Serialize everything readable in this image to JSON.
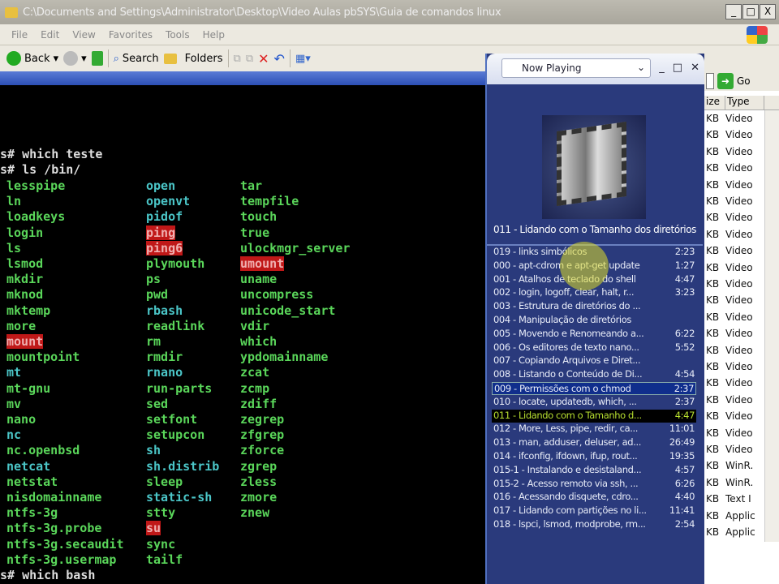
{
  "window": {
    "title": "C:\\Documents and Settings\\Administrator\\Desktop\\Video Aulas pbSYS\\Guia de comandos linux",
    "controls": [
      "_",
      "□",
      "X"
    ]
  },
  "menu": [
    "File",
    "Edit",
    "View",
    "Favorites",
    "Tools",
    "Help"
  ],
  "toolbar": {
    "back": "Back",
    "search": "Search",
    "folders": "Folders",
    "go": "Go"
  },
  "terminal": {
    "lines_top": [
      "s# which teste",
      "s# ls /bin/"
    ],
    "line_bottom": "s# which bash",
    "columns": [
      [
        [
          "lesspipe",
          "g"
        ],
        [
          "ln",
          "g"
        ],
        [
          "loadkeys",
          "g"
        ],
        [
          "login",
          "g"
        ],
        [
          "ls",
          "g"
        ],
        [
          "lsmod",
          "g"
        ],
        [
          "mkdir",
          "g"
        ],
        [
          "mknod",
          "g"
        ],
        [
          "mktemp",
          "g"
        ],
        [
          "more",
          "g"
        ],
        [
          "mount",
          "r"
        ],
        [
          "mountpoint",
          "g"
        ],
        [
          "mt",
          "c"
        ],
        [
          "mt-gnu",
          "g"
        ],
        [
          "mv",
          "g"
        ],
        [
          "nano",
          "g"
        ],
        [
          "nc",
          "c"
        ],
        [
          "nc.openbsd",
          "g"
        ],
        [
          "netcat",
          "c"
        ],
        [
          "netstat",
          "g"
        ],
        [
          "nisdomainname",
          "g"
        ],
        [
          "ntfs-3g",
          "g"
        ],
        [
          "ntfs-3g.probe",
          "g"
        ],
        [
          "ntfs-3g.secaudit",
          "g"
        ],
        [
          "ntfs-3g.usermap",
          "g"
        ]
      ],
      [
        [
          "open",
          "c"
        ],
        [
          "openvt",
          "c"
        ],
        [
          "pidof",
          "c"
        ],
        [
          "ping",
          "r"
        ],
        [
          "ping6",
          "r"
        ],
        [
          "plymouth",
          "g"
        ],
        [
          "ps",
          "g"
        ],
        [
          "pwd",
          "g"
        ],
        [
          "rbash",
          "c"
        ],
        [
          "readlink",
          "g"
        ],
        [
          "rm",
          "g"
        ],
        [
          "rmdir",
          "g"
        ],
        [
          "rnano",
          "c"
        ],
        [
          "run-parts",
          "g"
        ],
        [
          "sed",
          "g"
        ],
        [
          "setfont",
          "g"
        ],
        [
          "setupcon",
          "g"
        ],
        [
          "sh",
          "c"
        ],
        [
          "sh.distrib",
          "c"
        ],
        [
          "sleep",
          "g"
        ],
        [
          "static-sh",
          "c"
        ],
        [
          "stty",
          "g"
        ],
        [
          "su",
          "r"
        ],
        [
          "sync",
          "g"
        ],
        [
          "tailf",
          "g"
        ]
      ],
      [
        [
          "tar",
          "g"
        ],
        [
          "tempfile",
          "g"
        ],
        [
          "touch",
          "g"
        ],
        [
          "true",
          "g"
        ],
        [
          "ulockmgr_server",
          "g"
        ],
        [
          "umount",
          "r"
        ],
        [
          "uname",
          "g"
        ],
        [
          "uncompress",
          "g"
        ],
        [
          "unicode_start",
          "g"
        ],
        [
          "vdir",
          "g"
        ],
        [
          "which",
          "g"
        ],
        [
          "ypdomainname",
          "g"
        ],
        [
          "zcat",
          "g"
        ],
        [
          "zcmp",
          "g"
        ],
        [
          "zdiff",
          "g"
        ],
        [
          "zegrep",
          "g"
        ],
        [
          "zfgrep",
          "g"
        ],
        [
          "zforce",
          "g"
        ],
        [
          "zgrep",
          "g"
        ],
        [
          "zless",
          "g"
        ],
        [
          "zmore",
          "g"
        ],
        [
          "znew",
          "g"
        ]
      ]
    ]
  },
  "player": {
    "view": "Now Playing",
    "now_playing": "011 - Lidando com o Tamanho dos diretórios",
    "playlist": [
      {
        "title": "019 - links simbólicos",
        "time": "2:23"
      },
      {
        "title": "000 - apt-cdrom e apt-get update",
        "time": "1:27"
      },
      {
        "title": "001 - Atalhos de teclado do shell",
        "time": "4:47"
      },
      {
        "title": "002 - login, logoff, clear, halt, r...",
        "time": "3:23"
      },
      {
        "title": "003 - Estrutura de diretórios do ...",
        "time": ""
      },
      {
        "title": "004 - Manipulação de diretórios",
        "time": ""
      },
      {
        "title": "005 - Movendo e Renomeando a...",
        "time": "6:22"
      },
      {
        "title": "006 - Os editores de texto nano...",
        "time": "5:52"
      },
      {
        "title": "007 - Copiando Arquivos e Diret...",
        "time": ""
      },
      {
        "title": "008 - Listando o Conteúdo de Di...",
        "time": "4:54"
      },
      {
        "title": "009 - Permissões com o chmod",
        "time": "2:37",
        "state": "sel"
      },
      {
        "title": "010 - locate, updatedb, which, ...",
        "time": "2:37"
      },
      {
        "title": "011 - Lidando com o Tamanho d...",
        "time": "4:47",
        "state": "cur"
      },
      {
        "title": "012 - More, Less, pipe, redir, ca...",
        "time": "11:01"
      },
      {
        "title": "013 - man, adduser, deluser, ad...",
        "time": "26:49"
      },
      {
        "title": "014 - ifconfig, ifdown, ifup, rout...",
        "time": "19:35"
      },
      {
        "title": "015-1 - Instalando e desistaland...",
        "time": "4:57"
      },
      {
        "title": "015-2 - Acesso remoto via ssh, ...",
        "time": "6:26"
      },
      {
        "title": "016 - Acessando disquete, cdro...",
        "time": "4:40"
      },
      {
        "title": "017 - Lidando com partições no li...",
        "time": "11:41"
      },
      {
        "title": "018 - lspci, lsmod, modprobe, rm...",
        "time": "2:54"
      }
    ]
  },
  "explorer": {
    "headers": [
      "ize",
      "Type"
    ],
    "types": [
      "Video",
      "Video",
      "Video",
      "Video",
      "Video",
      "Video",
      "Video",
      "Video",
      "Video",
      "Video",
      "Video",
      "Video",
      "Video",
      "Video",
      "Video",
      "Video",
      "Video",
      "Video",
      "Video",
      "Video",
      "Video",
      "WinR.",
      "WinR.",
      "Text I",
      "Applic",
      "Applic"
    ],
    "size_unit": "KB"
  }
}
